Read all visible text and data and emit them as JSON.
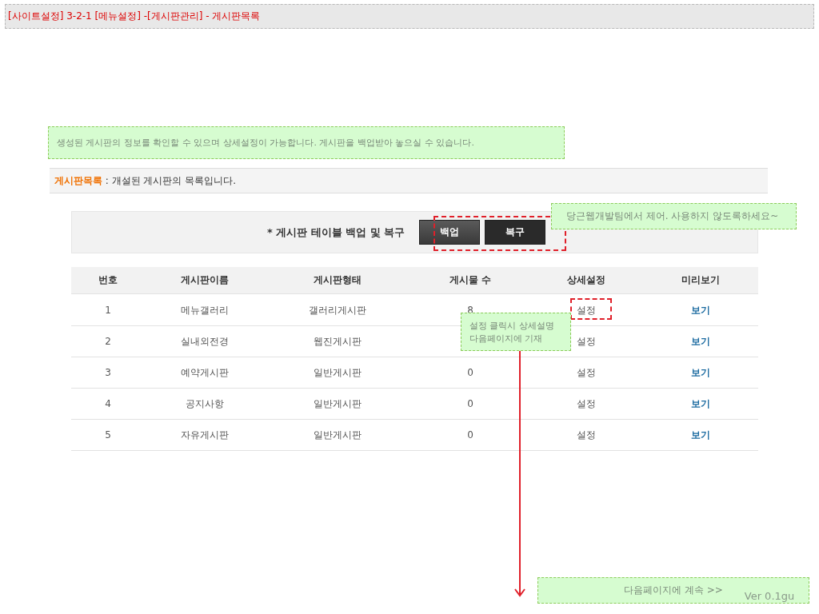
{
  "header": {
    "title": "[사이트설정] 3-2-1 [메뉴설정] -[게시판관리] - 게시판목록"
  },
  "intro_note": "생성된 게시판의 정보를 확인할 수 있으며 상세설정이 가능합니다. 게시판을 백업받아 놓으실 수 있습니다.",
  "section": {
    "title": "게시판목록",
    "description": " : 개설된 게시판의 목록입니다."
  },
  "backup_panel": {
    "label": "* 게시판 테이블 백업 및 복구",
    "buttons": [
      "백업",
      "복구"
    ]
  },
  "table": {
    "columns": [
      "번호",
      "게시판이름",
      "게시판형태",
      "게시물 수",
      "상세설정",
      "미리보기"
    ],
    "rows": [
      {
        "number": "1",
        "name": "메뉴갤러리",
        "type": "갤러리게시판",
        "count": "8",
        "settings": "설정",
        "preview": "보기"
      },
      {
        "number": "2",
        "name": "실내외전경",
        "type": "웹진게시판",
        "count": "",
        "settings": "설정",
        "preview": "보기"
      },
      {
        "number": "3",
        "name": "예약게시판",
        "type": "일반게시판",
        "count": "0",
        "settings": "설정",
        "preview": "보기"
      },
      {
        "number": "4",
        "name": "공지사항",
        "type": "일반게시판",
        "count": "0",
        "settings": "설정",
        "preview": "보기"
      },
      {
        "number": "5",
        "name": "자유게시판",
        "type": "일반게시판",
        "count": "0",
        "settings": "설정",
        "preview": "보기"
      }
    ]
  },
  "annotations": [
    {
      "kind": "note",
      "text": "당근웹개발팀에서 제어. 사용하지 않도록하세요~"
    },
    {
      "kind": "note",
      "text": "설정 클릭시 상세설명\n다음페이지에 기재"
    }
  ],
  "footer_note": {
    "text": "다음페이지에 계속 >>",
    "version": "Ver 0.1gu"
  }
}
